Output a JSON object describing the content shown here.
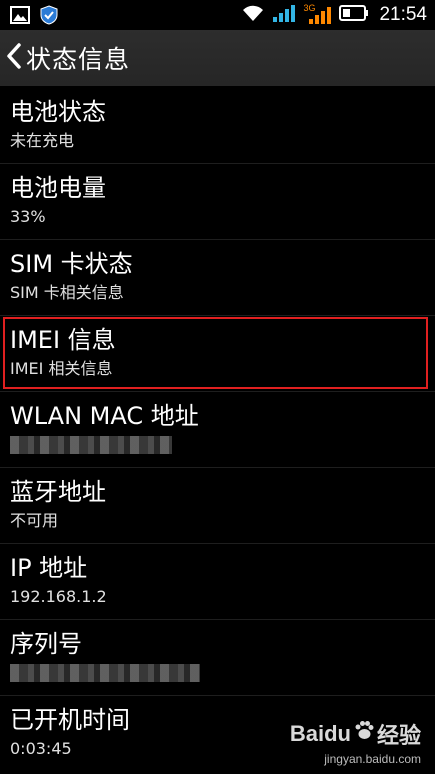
{
  "status_bar": {
    "time": "21:54",
    "network_label": "3G",
    "icons": [
      "image-icon",
      "shield-icon",
      "wifi-icon",
      "signal-icon",
      "signal-icon",
      "battery-icon"
    ]
  },
  "action_bar": {
    "title": "状态信息",
    "back_icon": "chevron-left-icon"
  },
  "items": [
    {
      "title": "电池状态",
      "summary": "未在充电"
    },
    {
      "title": "电池电量",
      "summary": "33%"
    },
    {
      "title": "SIM 卡状态",
      "summary": "SIM 卡相关信息"
    },
    {
      "title": "IMEI 信息",
      "summary": "IMEI 相关信息"
    },
    {
      "title": "WLAN MAC 地址",
      "summary": ""
    },
    {
      "title": "蓝牙地址",
      "summary": "不可用"
    },
    {
      "title": "IP 地址",
      "summary": "192.168.1.2"
    },
    {
      "title": "序列号",
      "summary": ""
    },
    {
      "title": "已开机时间",
      "summary": "0:03:45"
    }
  ],
  "watermark": {
    "brand": "Baidu",
    "brand_cn": "经验",
    "site": "jingyan.baidu.com"
  },
  "colors": {
    "highlight": "#e02020",
    "wifi": "#ffffff",
    "signal": "#33b5e5",
    "signal_3g": "#ff8800"
  }
}
